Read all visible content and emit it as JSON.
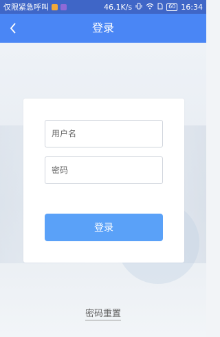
{
  "status_bar": {
    "carrier": "仅限紧急呼叫",
    "speed": "46.1K/s",
    "battery": "60",
    "time": "16:34"
  },
  "app_bar": {
    "title": "登录",
    "back_icon": "chevron-left-icon"
  },
  "form": {
    "username_placeholder": "用户名",
    "password_placeholder": "密码",
    "login_label": "登录"
  },
  "footer": {
    "reset_label": "密码重置"
  },
  "colors": {
    "status_bar": "#3f66c7",
    "app_bar": "#4a86f5",
    "button": "#5aa1f8"
  }
}
